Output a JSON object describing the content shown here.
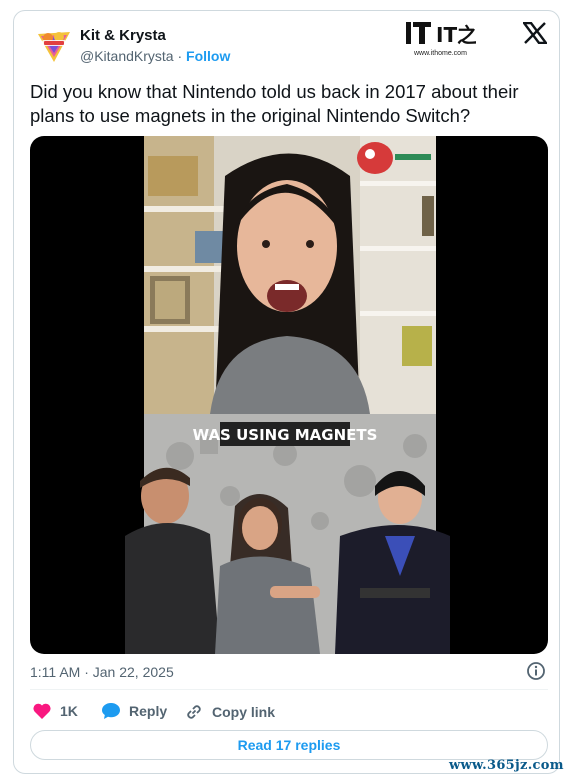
{
  "author": {
    "name": "Kit & Krysta",
    "handle": "@KitandKrysta",
    "separator": "·",
    "follow_label": "Follow"
  },
  "source_logo": {
    "text": "IT之家",
    "site": "www.ithome.com"
  },
  "tweet": {
    "text": "Did you know that Nintendo told us back in 2017 about their plans to use magnets in the original Nintendo Switch?",
    "timestamp": "1:11 AM · Jan 22, 2025"
  },
  "media": {
    "caption": "WAS USING MAGNETS"
  },
  "actions": {
    "like_count": "1K",
    "reply_label": "Reply",
    "copy_link_label": "Copy link",
    "read_replies_label": "Read 17 replies"
  },
  "watermark": "www.365jz.com",
  "colors": {
    "accent": "#1d9bf0",
    "like": "#f91880",
    "text": "#0f1419",
    "muted": "#536471",
    "border": "#cfd9de"
  }
}
